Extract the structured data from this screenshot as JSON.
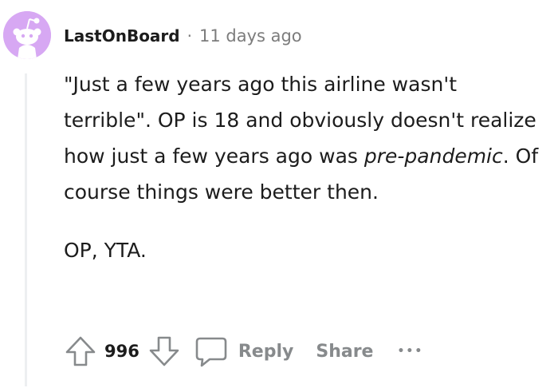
{
  "comment": {
    "username": "LastOnBoard",
    "separator": "·",
    "timestamp": "11 days ago",
    "body": {
      "line_before_italic_1": "\"Just a few years ago this airline wasn't terrible\". OP is 18 and obviously doesn't realize how just a few years ago was ",
      "italic_1": "pre-",
      "italic_2": "pandemic",
      "line_after_italic": ". Of course things were better then.",
      "reply": "OP, YTA."
    },
    "actions": {
      "score": "996",
      "reply_label": "Reply",
      "share_label": "Share",
      "more_label": "•••"
    }
  },
  "icons": {
    "avatar": "reddit-snoo-avatar-icon",
    "upvote": "upvote-arrow-icon",
    "downvote": "downvote-arrow-icon",
    "comment": "speech-bubble-icon"
  },
  "colors": {
    "avatar_bg": "#d7a8f3",
    "text": "#1c1c1c",
    "meta": "#7c7c7c",
    "action": "#878a8c",
    "thread_line": "#edeff1"
  }
}
